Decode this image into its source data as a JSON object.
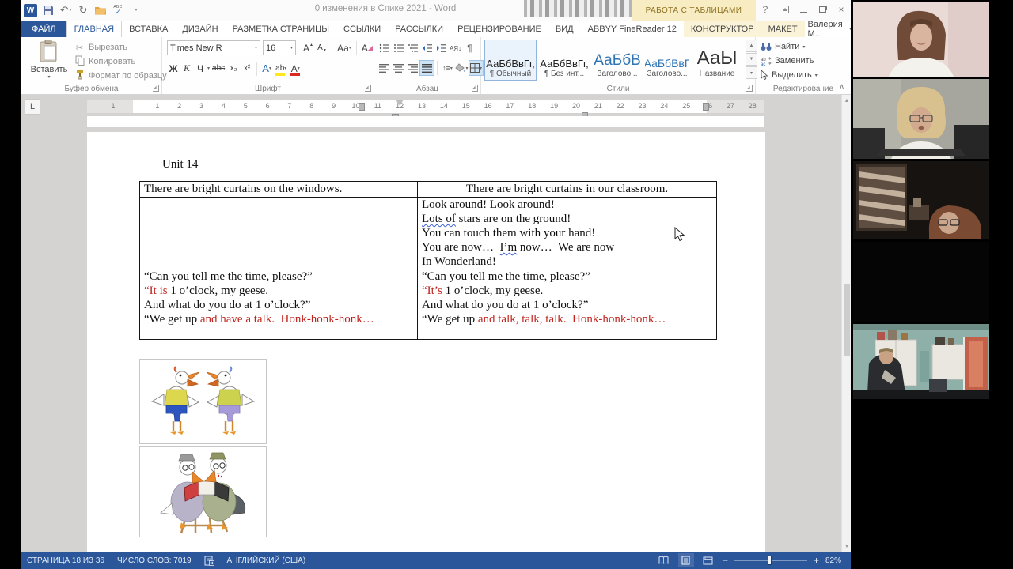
{
  "glyphs": {
    "caret_down": "▾",
    "undo": "↶",
    "redo": "↻",
    "cut": "✂",
    "abc_label": "ABC",
    "check": "✓",
    "close": "×",
    "help": "?",
    "minus": "−",
    "plus": "+",
    "collapse": "∧",
    "line_spacing": "↕≡",
    "tri_up": "▲",
    "tri_down": "▼",
    "scroll_up": "▲",
    "scroll_down": "▼",
    "word_logo": "W",
    "ruler_tab": "L"
  },
  "title_bar": {
    "title": "0 изменения в Спике 2021 - Word",
    "contextual_header": "РАБОТА С ТАБЛИЦАМИ"
  },
  "tabs": {
    "items": [
      {
        "label": "ФАЙЛ"
      },
      {
        "label": "ГЛАВНАЯ",
        "active": true
      },
      {
        "label": "ВСТАВКА"
      },
      {
        "label": "ДИЗАЙН"
      },
      {
        "label": "РАЗМЕТКА СТРАНИЦЫ"
      },
      {
        "label": "ССЫЛКИ"
      },
      {
        "label": "РАССЫЛКИ"
      },
      {
        "label": "РЕЦЕНЗИРОВАНИЕ"
      },
      {
        "label": "ВИД"
      },
      {
        "label": "ABBYY FineReader 12"
      },
      {
        "label": "КОНСТРУКТОР",
        "contextual": true
      },
      {
        "label": "МАКЕТ",
        "contextual": true
      }
    ],
    "user": "Валерия М..."
  },
  "ribbon": {
    "clipboard": {
      "paste": "Вставить",
      "cut": "Вырезать",
      "copy": "Копировать",
      "format_painter": "Формат по образцу",
      "group": "Буфер обмена"
    },
    "font": {
      "family": "Times New R",
      "size": "16",
      "bold": "Ж",
      "italic": "К",
      "underline": "Ч",
      "strike": "abc",
      "subscript": "x₂",
      "superscript": "x²",
      "grow": "А",
      "shrink": "А",
      "change_case": "Аа",
      "clear": "А",
      "text_effects": "А",
      "highlight": "ab",
      "font_color": "А",
      "group": "Шрифт"
    },
    "paragraph": {
      "sort": "АЯ↓",
      "pilcrow": "¶",
      "group": "Абзац"
    },
    "styles": {
      "group": "Стили",
      "items": [
        {
          "preview": "АаБбВвГг,",
          "label": "¶ Обычный",
          "selected": true
        },
        {
          "preview": "АаБбВвГг,",
          "label": "¶ Без инт..."
        },
        {
          "preview": "АаБбВ",
          "label": "Заголово..."
        },
        {
          "preview": "АаБбВвГ",
          "label": "Заголово..."
        },
        {
          "preview": "АаЫ",
          "label": "Название"
        }
      ]
    },
    "editing": {
      "find": "Найти",
      "replace": "Заменить",
      "select": "Выделить",
      "group": "Редактирование"
    }
  },
  "ruler": {
    "count": 28,
    "margin_number": "1"
  },
  "document": {
    "heading": "Unit 14",
    "table": {
      "rows": [
        {
          "cells": [
            {
              "align": "left",
              "lines": [
                [
                  {
                    "t": "There are bright curtains on the windows."
                  }
                ]
              ]
            },
            {
              "align": "center",
              "lines": [
                [
                  {
                    "t": "There are bright curtains in our classroom."
                  }
                ]
              ]
            }
          ]
        },
        {
          "cells": [
            {
              "align": "left",
              "lines": []
            },
            {
              "align": "left",
              "lines": [
                [
                  {
                    "t": "Look around! Look around!"
                  }
                ],
                [
                  {
                    "t": "Lots of",
                    "sq": true
                  },
                  {
                    "t": " stars are on the ground!"
                  }
                ],
                [
                  {
                    "t": "You can touch them with your hand!"
                  }
                ],
                [
                  {
                    "t": "You are now…  "
                  },
                  {
                    "t": "I’m",
                    "sq": true
                  },
                  {
                    "t": " now…  We are now"
                  }
                ],
                [
                  {
                    "t": "In Wonderland!"
                  }
                ]
              ]
            }
          ]
        },
        {
          "cells": [
            {
              "align": "left",
              "lines": [
                [
                  {
                    "t": "“Can you tell me the time, please?”"
                  }
                ],
                [
                  {
                    "t": "“It is",
                    "red": true
                  },
                  {
                    "t": " 1 o’clock, my geese."
                  }
                ],
                [
                  {
                    "t": "And what do you do at 1 o’clock?”"
                  }
                ],
                [
                  {
                    "t": "“We get up "
                  },
                  {
                    "t": "and have a talk.  Honk-honk-honk…",
                    "red": true
                  }
                ]
              ]
            },
            {
              "align": "left",
              "lines": [
                [
                  {
                    "t": "“Can you tell me the time, please?”"
                  }
                ],
                [
                  {
                    "t": "“It’s",
                    "red": true
                  },
                  {
                    "t": " 1 o’clock, my geese."
                  }
                ],
                [
                  {
                    "t": "And what do you do at 1 o’clock?”"
                  }
                ],
                [
                  {
                    "t": "“We get up "
                  },
                  {
                    "t": "and talk, talk, talk.  Honk-honk-honk…",
                    "red": true
                  }
                ]
              ]
            }
          ]
        }
      ]
    },
    "figures": [
      {
        "name": "two-geese-talking"
      },
      {
        "name": "two-geese-reading"
      }
    ]
  },
  "status_bar": {
    "page": "СТРАНИЦА 18 ИЗ 36",
    "words": "ЧИСЛО СЛОВ: 7019",
    "language": "АНГЛИЙСКИЙ (США)",
    "zoom": "82%"
  },
  "colors": {
    "accent": "#2b579a",
    "status_bar": "#2b579a",
    "document_red": "#c0241e",
    "contextual_yellow": "#f7ecc2",
    "squiggle_blue": "#3a5fd0"
  }
}
